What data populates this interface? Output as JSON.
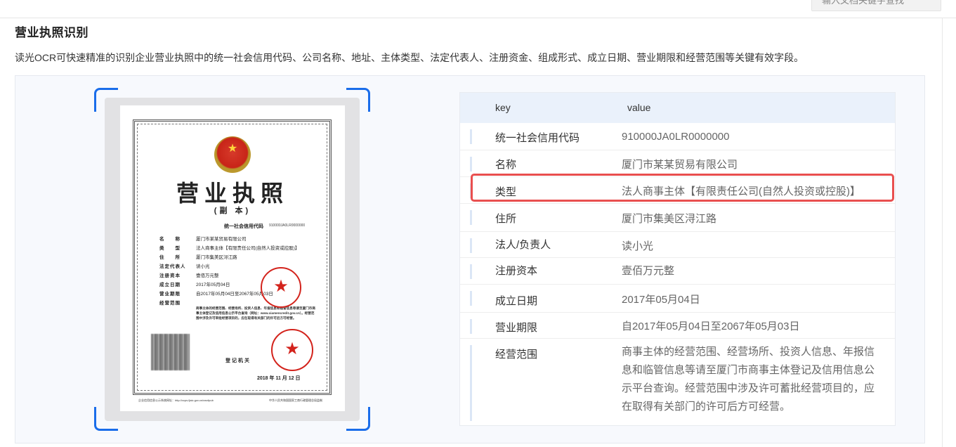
{
  "header": {
    "search_placeholder": "输入文档关键字查找"
  },
  "section": {
    "title": "营业执照识别",
    "description": "读光OCR可快速精准的识别企业营业执照中的统一社会信用代码、公司名称、地址、主体类型、法定代表人、注册资金、组成形式、成立日期、营业期限和经营范围等关键有效字段。"
  },
  "license": {
    "title": "营业执照",
    "subtitle": "(副 本)",
    "code_label": "统一社会信用代码",
    "code": "910000JA0LR0000000",
    "rows": [
      {
        "label": "名　　称",
        "value": "厦门市某某贸易有限公司"
      },
      {
        "label": "类　　型",
        "value": "法人商事主体【有限责任公司(自然人投资或控股)】"
      },
      {
        "label": "住　　所",
        "value": "厦门市集美区浔江路"
      },
      {
        "label": "法定代表人",
        "value": "读小光"
      },
      {
        "label": "注册资本",
        "value": "壹佰万元整"
      },
      {
        "label": "成立日期",
        "value": "2017年05月04日"
      },
      {
        "label": "营业期限",
        "value": "自2017年05月04日至2067年05月03日"
      },
      {
        "label": "经营范围",
        "value": ""
      }
    ],
    "scope_text": "商事主体的经营范围、经营场所、投资人信息、年报信息和临管信息等请至厦门市商事主体登记及信用信息公示平台查询（网址：www.xiamencredit.gov.cn）。经营范围中涉及许可审批经营项目的，应在取得有关部门的许可后方可经营。",
    "registrar": "登记机关",
    "date": "2018 年 11 月 12 日",
    "footer_left": "企业信用信息公示系统网址：http://vcps.fjaic.gov.cn/xwxfpub",
    "footer_right": "中华人民共和国国家工商行政管理总局监制"
  },
  "result": {
    "header_key": "key",
    "header_value": "value",
    "rows": [
      {
        "key": "统一社会信用代码",
        "value": "910000JA0LR0000000"
      },
      {
        "key": "名称",
        "value": "厦门市某某贸易有限公司"
      },
      {
        "key": "类型",
        "value": "法人商事主体【有限责任公司(自然人投资或控股)】"
      },
      {
        "key": "住所",
        "value": "厦门市集美区浔江路"
      },
      {
        "key": "法人/负责人",
        "value": "读小光"
      },
      {
        "key": "注册资本",
        "value": "壹佰万元整"
      },
      {
        "key": "成立日期",
        "value": "2017年05月04日"
      },
      {
        "key": "营业期限",
        "value": "自2017年05月04日至2067年05月03日"
      },
      {
        "key": "经营范围",
        "value": "商事主体的经营范围、经营场所、投资人信息、年报信息和临管信息等请至厦门市商事主体登记及信用信息公示平台查询。经营范围中涉及许可蓄批经营项目的，应在取得有关部门的许可后方可经营。"
      }
    ]
  }
}
